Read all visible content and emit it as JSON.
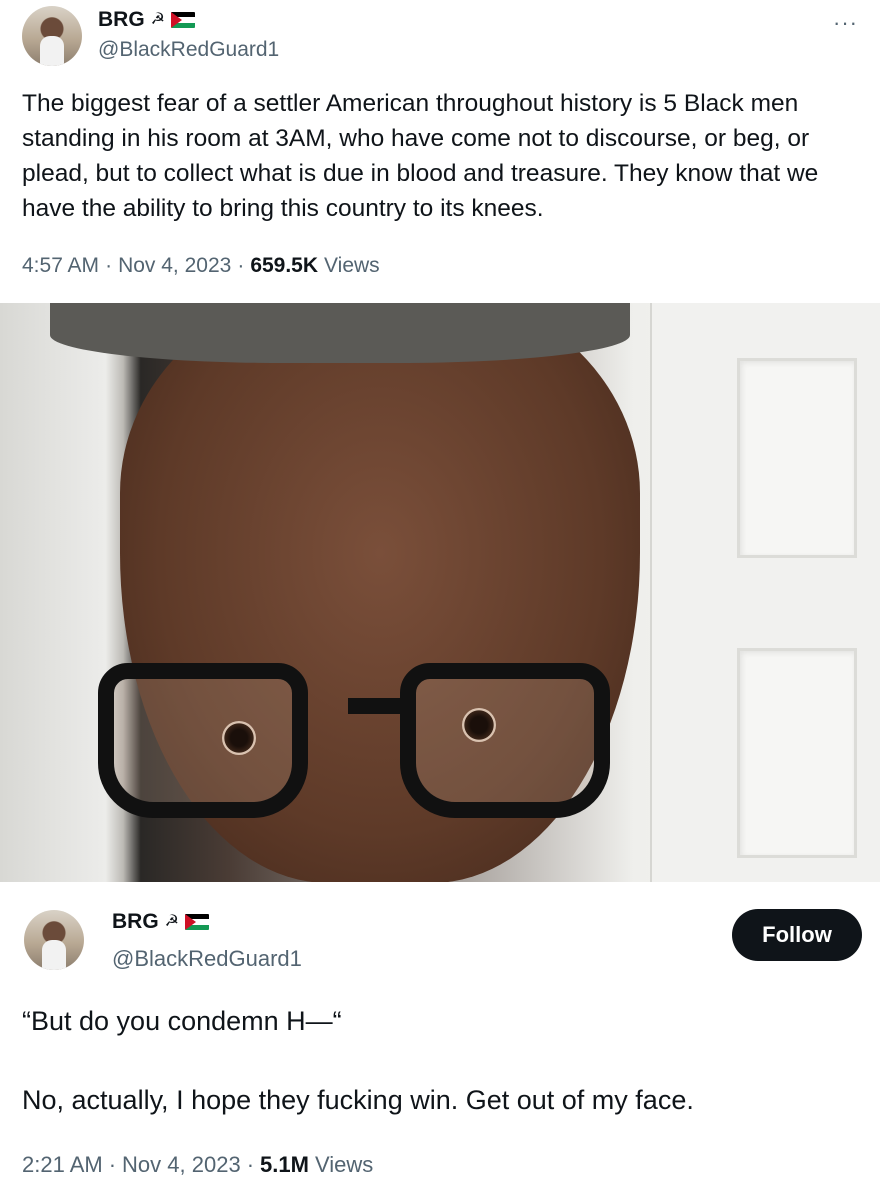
{
  "tweet_1": {
    "display_name": "BRG",
    "handle": "@BlackRedGuard1",
    "name_icon": "hammer-sickle-icon",
    "flag_icon": "palestine-flag-icon",
    "more_icon": "more-options-icon",
    "text": "The biggest fear of a settler American throughout history is 5 Black men standing in his room at 3AM, who have come not to discourse, or beg, or plead, but to collect what is due in blood and treasure. They know that we have the ability to bring this country to its knees.",
    "time": "4:57 AM",
    "date": "Nov 4, 2023",
    "views_count": "659.5K",
    "views_label": "Views",
    "separator": "·"
  },
  "photo": {
    "subject": "selfie-photo"
  },
  "tweet_2": {
    "display_name": "BRG",
    "handle": "@BlackRedGuard1",
    "name_icon": "hammer-sickle-icon",
    "flag_icon": "palestine-flag-icon",
    "follow_label": "Follow",
    "text_line_1": "“But do you condemn H—“",
    "text_line_2": "No, actually, I hope they fucking win. Get out of my face.",
    "time": "2:21 AM",
    "date": "Nov 4, 2023",
    "views_count": "5.1M",
    "views_label": "Views",
    "separator": "·"
  },
  "colors": {
    "text_primary": "#0f1419",
    "text_secondary": "#536471",
    "button_bg": "#0f1419",
    "flag_black": "#000000",
    "flag_white": "#ffffff",
    "flag_green": "#149954",
    "flag_red": "#ce1126"
  }
}
